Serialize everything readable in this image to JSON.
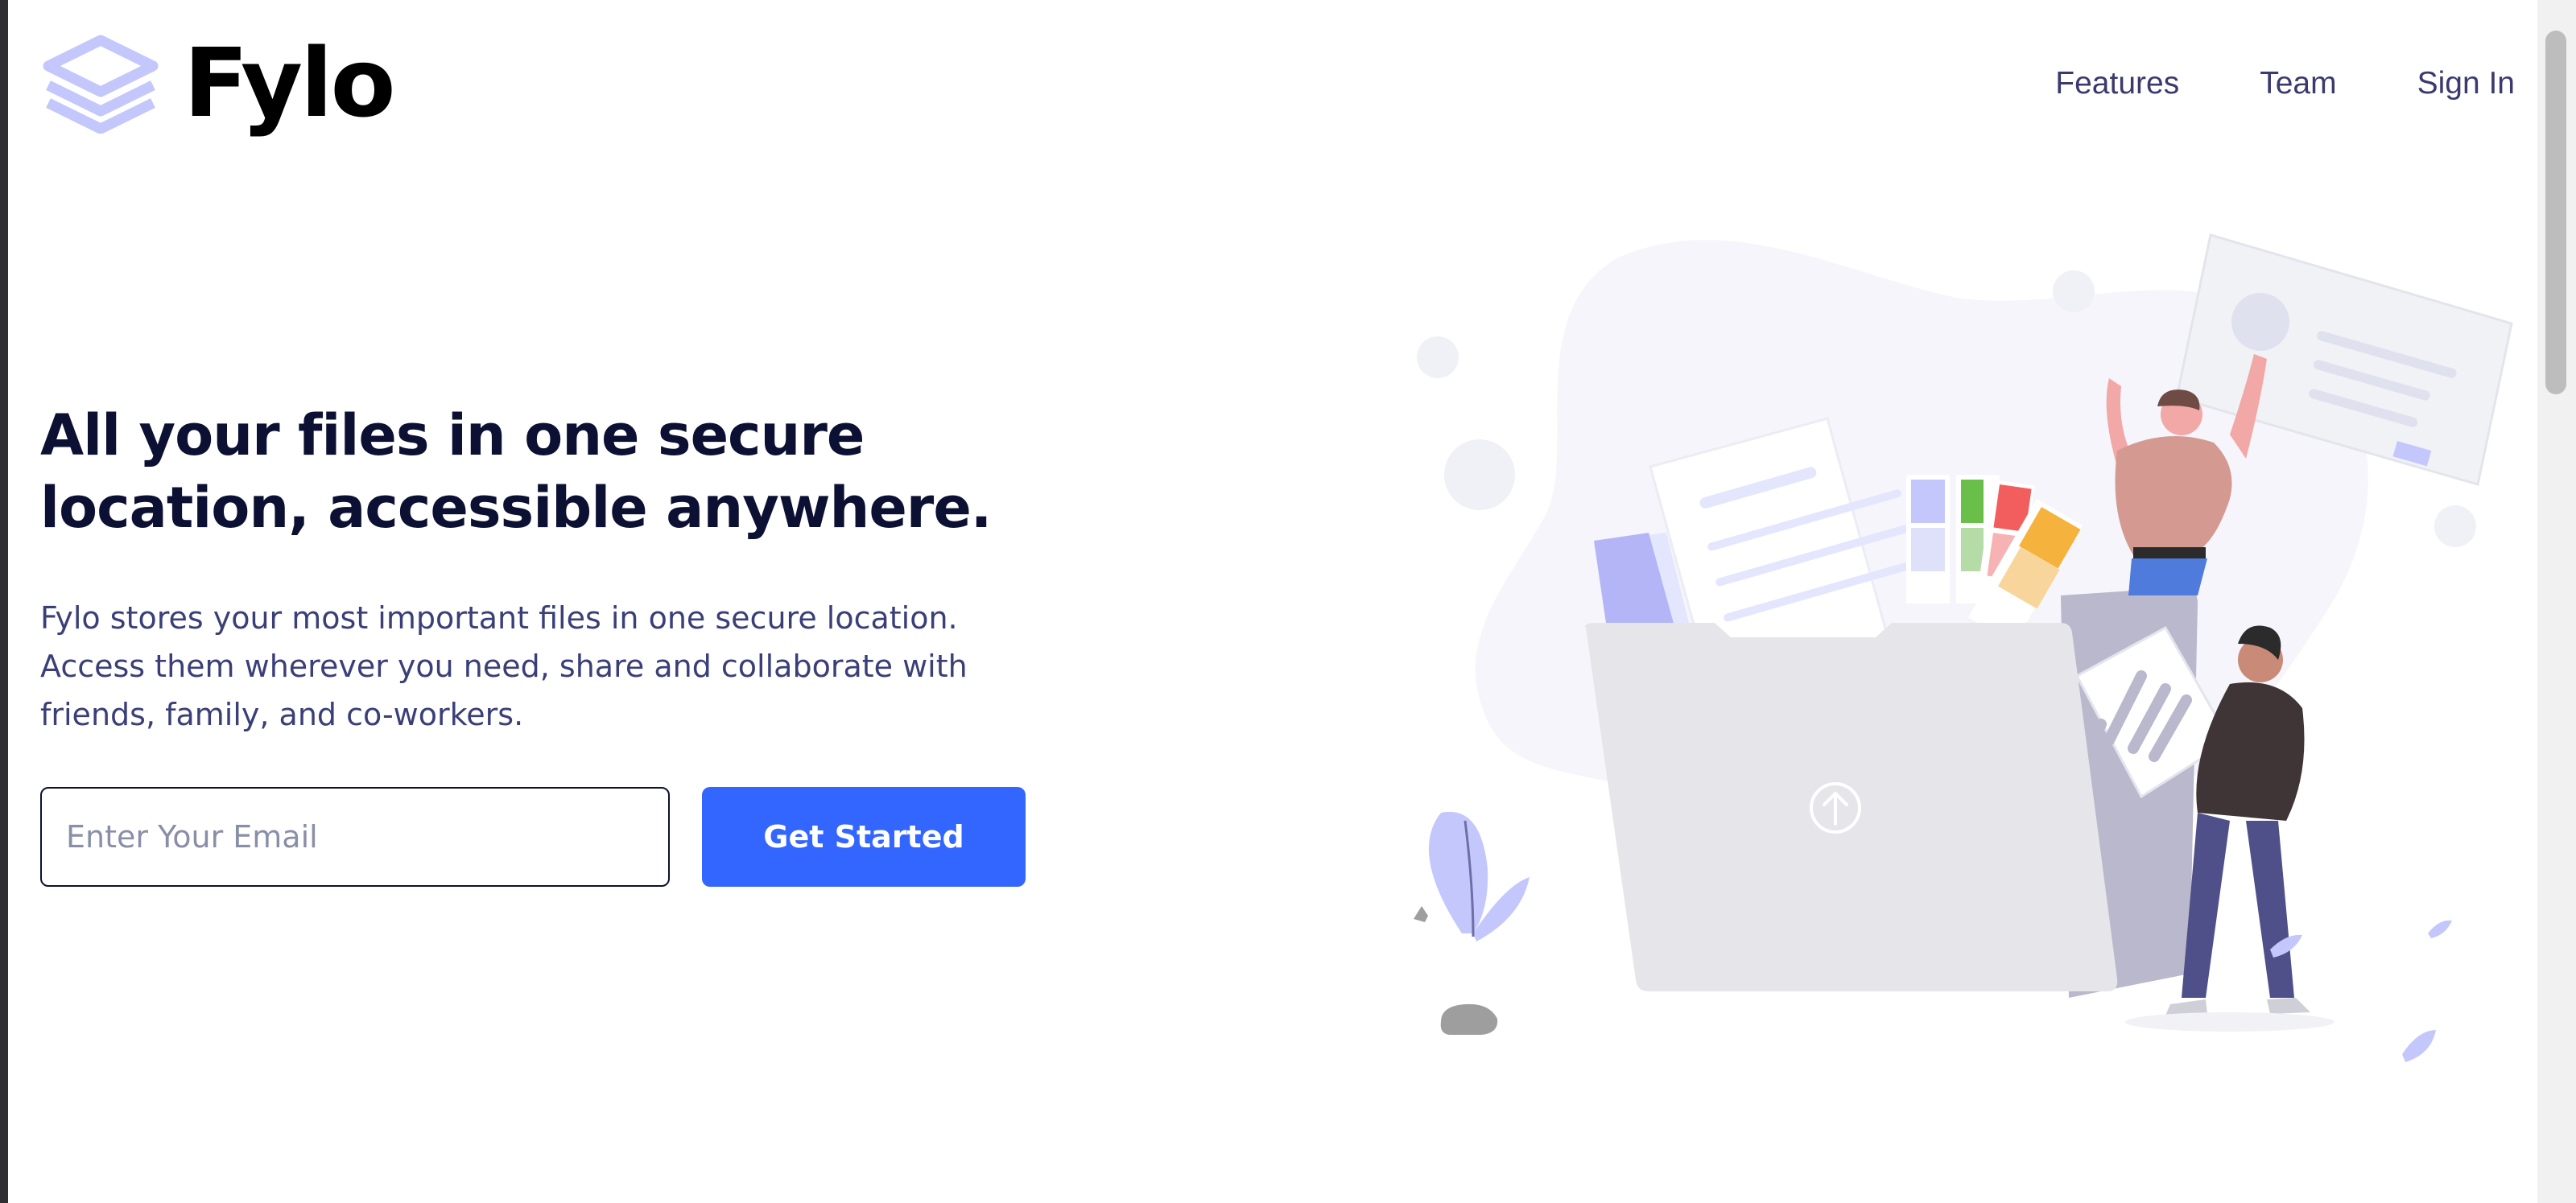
{
  "brand": {
    "name": "Fylo"
  },
  "nav": {
    "items": [
      "Features",
      "Team",
      "Sign In"
    ]
  },
  "hero": {
    "headline_line1": "All your files in one secure",
    "headline_line2": "location, accessible anywhere.",
    "subtext_line1": "Fylo stores your most important files in one secure location.",
    "subtext_line2": "Access them wherever you need, share and collaborate with",
    "subtext_line3": "friends, family, and co-workers.",
    "email_placeholder": "Enter Your Email",
    "email_value": "",
    "cta_label": "Get Started"
  },
  "colors": {
    "primary_button": "#3366ff",
    "heading": "#0c1033",
    "body_text": "#3a3f78",
    "logo_mark": "#c4c7fb"
  },
  "icons": [
    "stacked-layers-logo-icon",
    "upload-arrow-icon"
  ]
}
